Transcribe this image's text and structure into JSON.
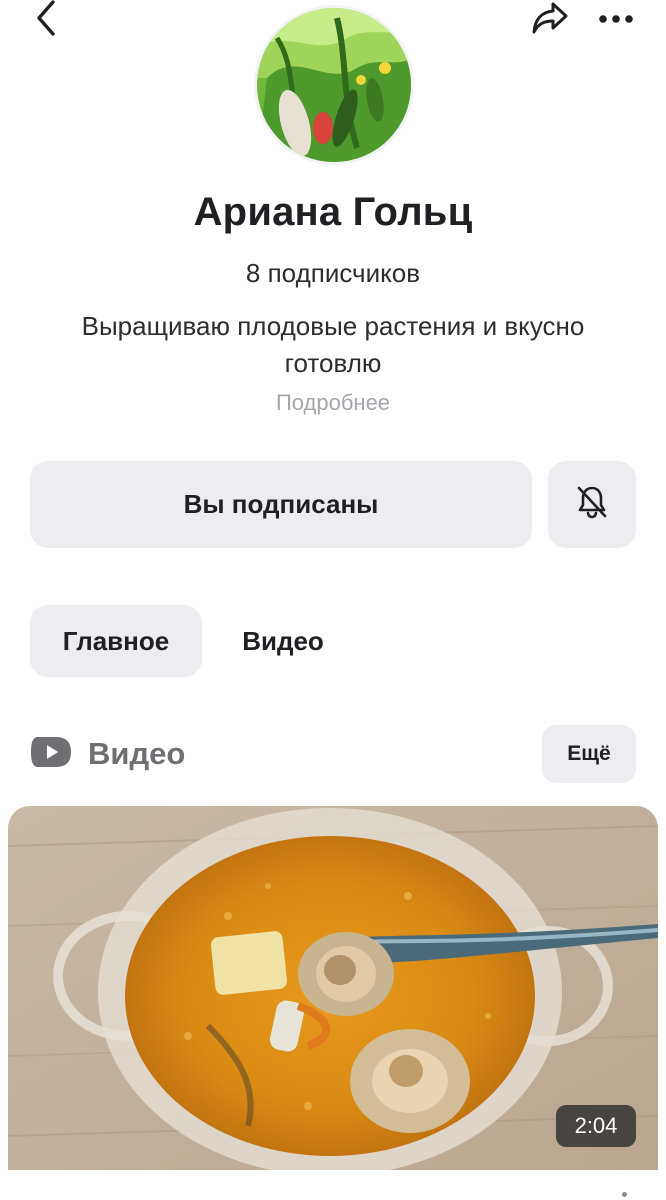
{
  "header": {
    "back_icon": "chevron-left-icon",
    "share_icon": "share-arrow-icon",
    "more_icon": "more-horizontal-icon"
  },
  "profile": {
    "avatar": "cucumber-plant-photo",
    "name": "Ариана Гольц",
    "subscribers": "8 подписчиков",
    "bio": "Выращиваю плодовые растения и вкусно готовлю",
    "more_link": "Подробнее"
  },
  "actions": {
    "subscribe_label": "Вы подписаны",
    "bell_icon": "bell-off-icon"
  },
  "tabs": [
    {
      "label": "Главное",
      "active": true
    },
    {
      "label": "Видео",
      "active": false
    }
  ],
  "video_section": {
    "icon": "video-play-icon",
    "title": "Видео",
    "more_label": "Ещё",
    "videos": [
      {
        "thumbnail": "mushroom-soup-photo",
        "duration": "2:04"
      }
    ]
  },
  "colors": {
    "button_bg": "#ebedf0",
    "text_primary": "#1f1f24",
    "text_secondary": "#a3a6ab",
    "section_title": "#6d6f73"
  }
}
